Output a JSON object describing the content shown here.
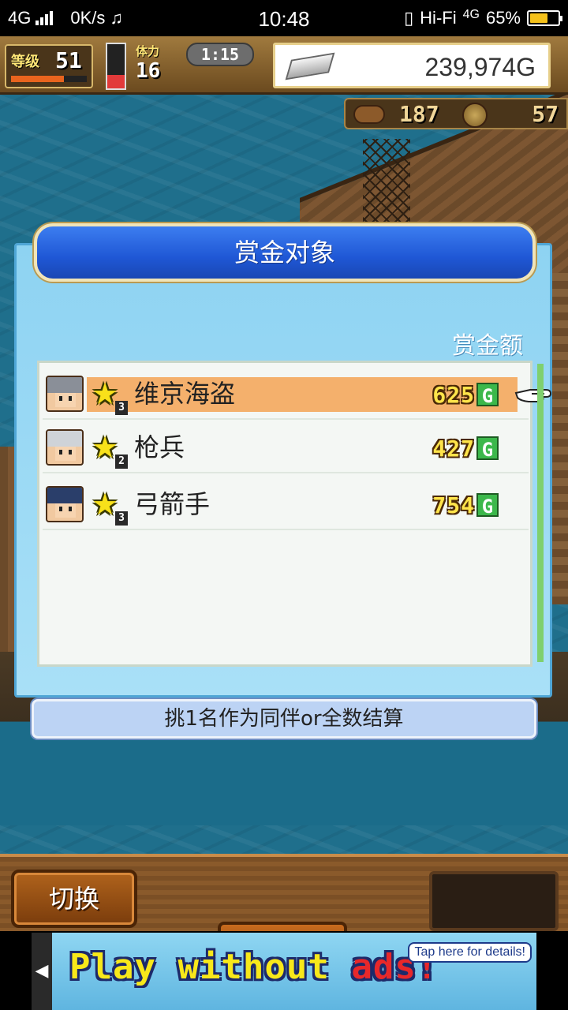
{
  "status_bar": {
    "network": "4G",
    "speed": "0K/s",
    "time": "10:48",
    "wifi": "Hi-Fi",
    "network2": "4G",
    "battery": "65%",
    "battery_level": 0.65
  },
  "hud": {
    "level_label": "等级",
    "level": "51",
    "level_progress": 0.7,
    "stamina_fill": 0.3,
    "stamina_label": "体力",
    "stamina": "16",
    "timer": "1:15",
    "gold": "239,974G",
    "resource1": "187",
    "resource2": "57"
  },
  "dialog": {
    "title": "赏金对象",
    "column_header": "赏金额",
    "rows": [
      {
        "name": "维京海盗",
        "rank": "3",
        "bounty": "625",
        "currency": "G",
        "selected": true
      },
      {
        "name": "枪兵",
        "rank": "2",
        "bounty": "427",
        "currency": "G",
        "selected": false
      },
      {
        "name": "弓箭手",
        "rank": "3",
        "bounty": "754",
        "currency": "G",
        "selected": false
      }
    ],
    "hint": "挑1名作为同伴or全数结算"
  },
  "bottom": {
    "switch_label": "切换"
  },
  "ad": {
    "text_main": "Play without ",
    "text_red": "ads!",
    "tap": "Tap here for details!"
  },
  "colors": {
    "selected_row": "#f4b06c",
    "dialog_title_bg": "#2a64e0",
    "bounty_text": "#ffe44a",
    "currency_badge": "#3cb84b"
  }
}
